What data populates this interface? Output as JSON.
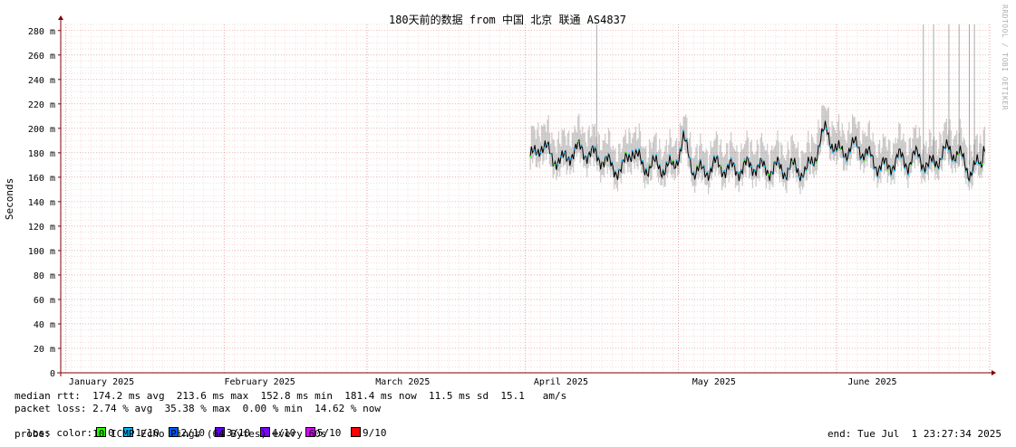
{
  "chart_data": {
    "type": "line",
    "title": "180天前的数据 from 中国 北京 联通 AS4837",
    "ylabel": "Seconds",
    "xlabel": "",
    "ylim": [
      0,
      285
    ],
    "y_ticks": [
      "0",
      "20 m",
      "40 m",
      "60 m",
      "80 m",
      "100 m",
      "120 m",
      "140 m",
      "160 m",
      "180 m",
      "200 m",
      "220 m",
      "240 m",
      "260 m",
      "280 m"
    ],
    "y_tick_values": [
      0,
      20,
      40,
      60,
      80,
      100,
      120,
      140,
      160,
      180,
      200,
      220,
      240,
      260,
      280
    ],
    "x_ticks": [
      "January 2025",
      "February 2025",
      "March 2025",
      "April 2025",
      "May 2025",
      "June 2025"
    ],
    "x_range": [
      "2024-12-31",
      "2025-07-01"
    ],
    "x_tick_dates": [
      "2025-01-08",
      "2025-02-08",
      "2025-03-08",
      "2025-04-08",
      "2025-05-08",
      "2025-06-08"
    ],
    "grid": true,
    "series": [
      {
        "name": "median rtt",
        "start": "2025-04-02",
        "end": "2025-06-30",
        "samples": [
          {
            "d": "2025-04-02",
            "v": 174
          },
          {
            "d": "2025-04-04",
            "v": 187
          },
          {
            "d": "2025-04-06",
            "v": 178
          },
          {
            "d": "2025-04-08",
            "v": 172
          },
          {
            "d": "2025-04-10",
            "v": 180
          },
          {
            "d": "2025-04-12",
            "v": 183
          },
          {
            "d": "2025-04-14",
            "v": 178
          },
          {
            "d": "2025-04-16",
            "v": 176
          },
          {
            "d": "2025-04-18",
            "v": 168
          },
          {
            "d": "2025-04-20",
            "v": 166
          },
          {
            "d": "2025-04-22",
            "v": 184
          },
          {
            "d": "2025-04-24",
            "v": 168
          },
          {
            "d": "2025-04-26",
            "v": 170
          },
          {
            "d": "2025-04-28",
            "v": 168
          },
          {
            "d": "2025-04-30",
            "v": 168
          },
          {
            "d": "2025-05-02",
            "v": 190
          },
          {
            "d": "2025-05-04",
            "v": 166
          },
          {
            "d": "2025-05-06",
            "v": 164
          },
          {
            "d": "2025-05-08",
            "v": 170
          },
          {
            "d": "2025-05-10",
            "v": 168
          },
          {
            "d": "2025-05-12",
            "v": 166
          },
          {
            "d": "2025-05-14",
            "v": 168
          },
          {
            "d": "2025-05-16",
            "v": 170
          },
          {
            "d": "2025-05-18",
            "v": 166
          },
          {
            "d": "2025-05-20",
            "v": 168
          },
          {
            "d": "2025-05-22",
            "v": 166
          },
          {
            "d": "2025-05-24",
            "v": 168
          },
          {
            "d": "2025-05-26",
            "v": 163
          },
          {
            "d": "2025-05-28",
            "v": 180
          },
          {
            "d": "2025-05-30",
            "v": 200
          },
          {
            "d": "2025-06-01",
            "v": 180
          },
          {
            "d": "2025-06-03",
            "v": 182
          },
          {
            "d": "2025-06-05",
            "v": 186
          },
          {
            "d": "2025-06-07",
            "v": 178
          },
          {
            "d": "2025-06-09",
            "v": 170
          },
          {
            "d": "2025-06-11",
            "v": 168
          },
          {
            "d": "2025-06-13",
            "v": 176
          },
          {
            "d": "2025-06-15",
            "v": 172
          },
          {
            "d": "2025-06-17",
            "v": 178
          },
          {
            "d": "2025-06-19",
            "v": 168
          },
          {
            "d": "2025-06-21",
            "v": 176
          },
          {
            "d": "2025-06-23",
            "v": 183
          },
          {
            "d": "2025-06-25",
            "v": 178
          },
          {
            "d": "2025-06-27",
            "v": 165
          },
          {
            "d": "2025-06-29",
            "v": 170
          },
          {
            "d": "2025-06-30",
            "v": 181
          }
        ]
      }
    ],
    "spikes": [
      {
        "d": "2025-04-15",
        "v": 285
      },
      {
        "d": "2025-06-18",
        "v": 285
      },
      {
        "d": "2025-06-20",
        "v": 285
      },
      {
        "d": "2025-06-23",
        "v": 285
      },
      {
        "d": "2025-06-25",
        "v": 285
      },
      {
        "d": "2025-06-27",
        "v": 285
      },
      {
        "d": "2025-06-28",
        "v": 285
      }
    ]
  },
  "colors": {
    "background": "#ffffff",
    "grid_minor": "#f2c0c0",
    "grid_major": "#e08080",
    "axis": "#800000",
    "median_line": "#000000",
    "smoke": "#666666",
    "loss_0": "#26ff00",
    "loss_1": "#00b8ff",
    "loss_2": "#0059ff",
    "loss_3": "#5e00ff",
    "loss_4": "#7e00ff",
    "loss_5": "#dd00ff",
    "loss_9": "#ff0000"
  },
  "stats": {
    "median_rtt": "median rtt:  174.2 ms avg  213.6 ms max  152.8 ms min  181.4 ms now  11.5 ms sd  15.1   am/s",
    "packet_loss": "packet loss: 2.74 % avg  35.38 % max  0.00 % min  14.62 % now",
    "loss_color_label": "loss color:",
    "loss_items": [
      "0",
      "1/10",
      "2/10",
      "3/10",
      "4/10",
      "5/10",
      "9/10"
    ],
    "probe": "probe:       10 ICMP Echo Pings (64 Bytes) every 60s",
    "end": "end: Tue Jul  1 23:27:34 2025"
  },
  "credit": "RRDTOOL / TOBI OETIKER"
}
